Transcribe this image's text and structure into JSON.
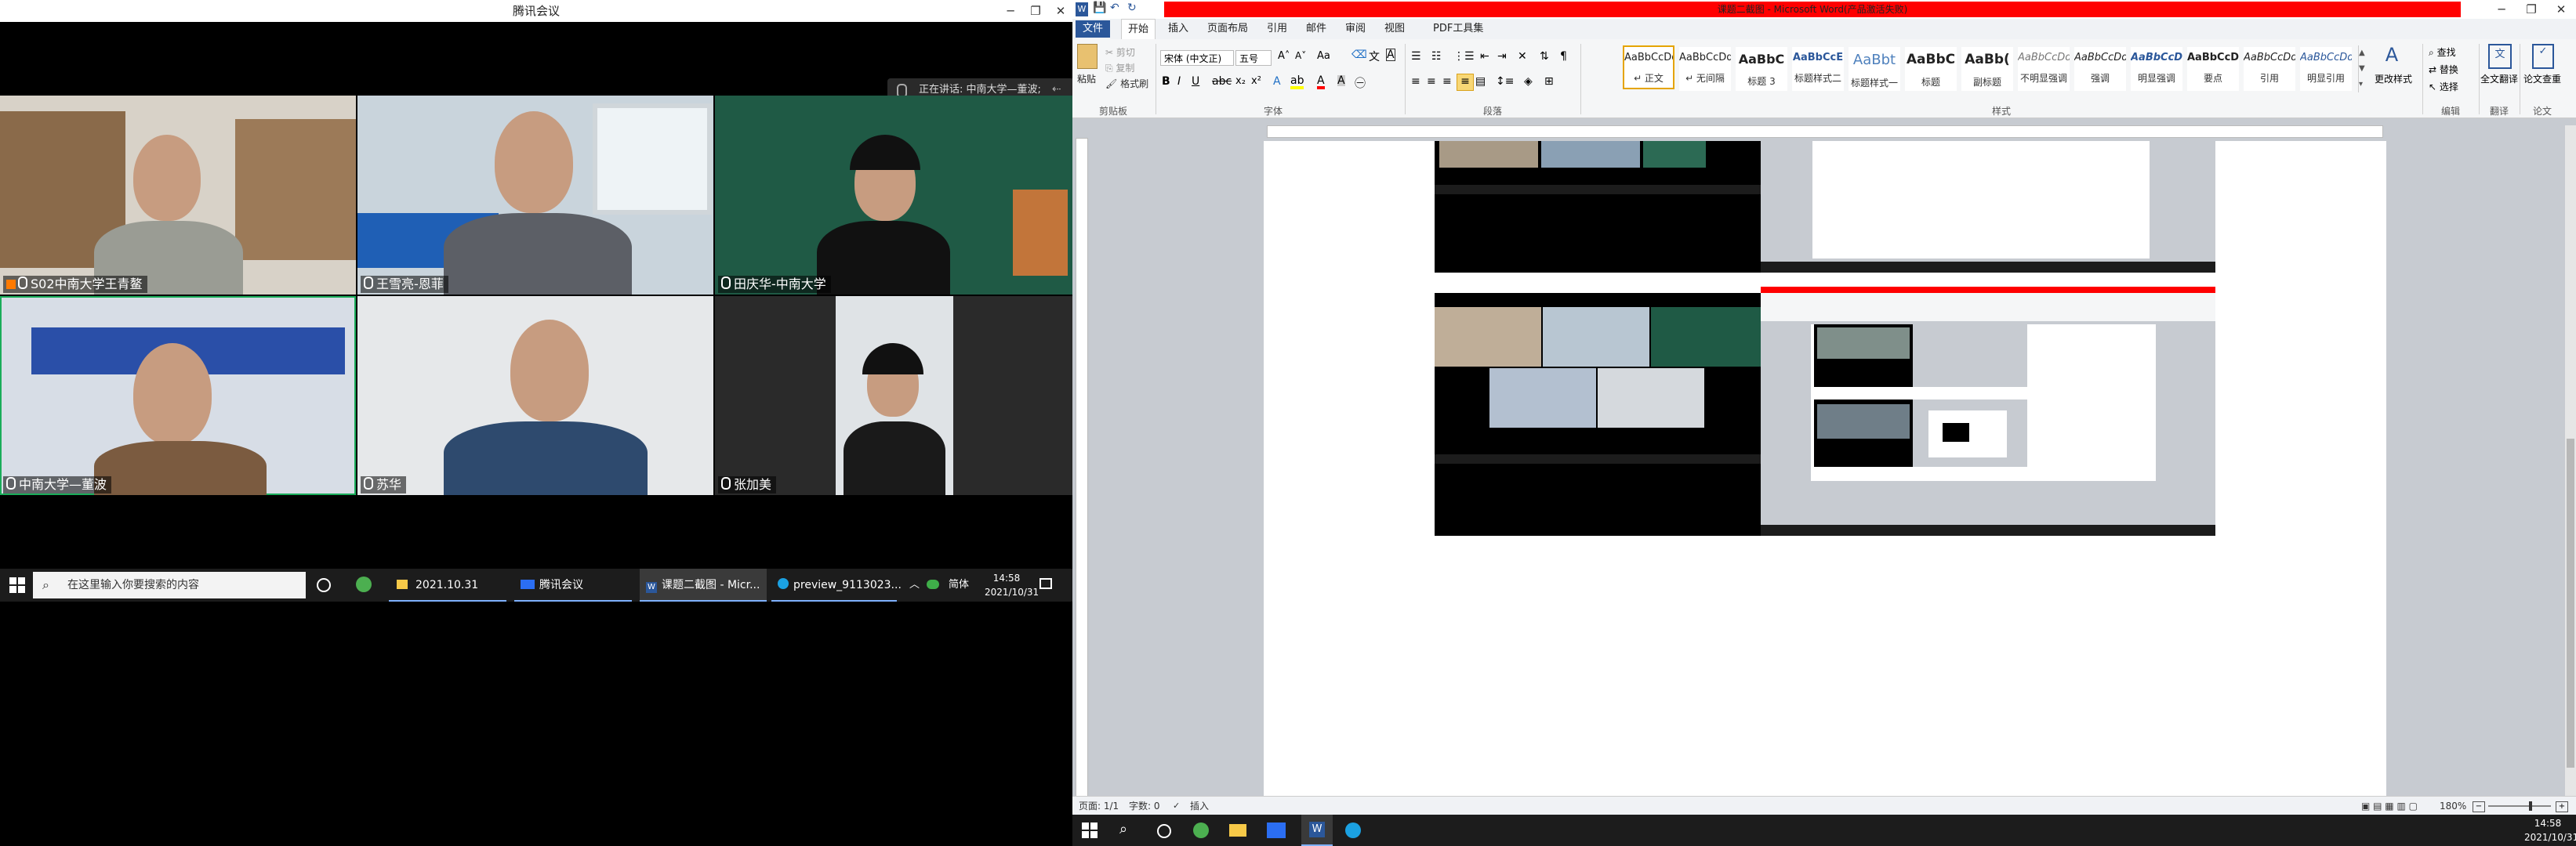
{
  "meeting": {
    "window_title": "腾讯会议",
    "speaking_text": "正在讲话: 中南大学—董波;",
    "participants": [
      {
        "name": "S02中南大学王青鳌"
      },
      {
        "name": "王雪亮-恩菲"
      },
      {
        "name": "田庆华-中南大学"
      },
      {
        "name": "中南大学—董波"
      },
      {
        "name": "苏华"
      },
      {
        "name": "张加美"
      }
    ]
  },
  "left_taskbar": {
    "search_placeholder": "在这里输入你要搜索的内容",
    "apps": [
      {
        "label": "2021.10.31"
      },
      {
        "label": "腾讯会议"
      },
      {
        "label": "课题二截图 - Micr..."
      },
      {
        "label": "preview_9113023..."
      }
    ],
    "ime": "简体",
    "time": "14:58",
    "date": "2021/10/31"
  },
  "word": {
    "title": "课题二截图 - Microsoft Word(产品激活失败)",
    "tabs": [
      {
        "label": "文件"
      },
      {
        "label": "开始"
      },
      {
        "label": "插入"
      },
      {
        "label": "页面布局"
      },
      {
        "label": "引用"
      },
      {
        "label": "邮件"
      },
      {
        "label": "审阅"
      },
      {
        "label": "视图"
      },
      {
        "label": "PDF工具集"
      }
    ],
    "clipboard": {
      "paste": "粘贴",
      "cut": "剪切",
      "copy": "复制",
      "format_painter": "格式刷",
      "group": "剪贴板"
    },
    "font": {
      "name": "宋体 (中文正)",
      "size": "五号",
      "group": "字体"
    },
    "paragraph": {
      "group": "段落"
    },
    "styles": {
      "group": "样式",
      "items": [
        {
          "sample": "AaBbCcDd",
          "name": "↵ 正文"
        },
        {
          "sample": "AaBbCcDd",
          "name": "↵ 无间隔"
        },
        {
          "sample": "AaBbC",
          "name": "标题 3"
        },
        {
          "sample": "AaBbCcE",
          "name": "标题样式二"
        },
        {
          "sample": "AaBbt",
          "name": "标题样式一"
        },
        {
          "sample": "AaBbC",
          "name": "标题"
        },
        {
          "sample": "AaBb(",
          "name": "副标题"
        },
        {
          "sample": "AaBbCcDd",
          "name": "不明显强调"
        },
        {
          "sample": "AaBbCcDd",
          "name": "强调"
        },
        {
          "sample": "AaBbCcDd",
          "name": "明显强调"
        },
        {
          "sample": "AaBbCcDd",
          "name": "要点"
        },
        {
          "sample": "AaBbCcDd",
          "name": "引用"
        },
        {
          "sample": "AaBbCcDd",
          "name": "明显引用"
        }
      ],
      "change_styles": "更改样式"
    },
    "editing": {
      "find": "查找",
      "replace": "替换",
      "select": "选择",
      "group": "编辑"
    },
    "translate": {
      "full": "全文翻译",
      "group": "翻译"
    },
    "paper": {
      "check": "论文查重",
      "group": "论文"
    },
    "status": {
      "page": "页面: 1/1",
      "words": "字数: 0",
      "mode": "插入",
      "zoom": "180%"
    },
    "taskbar": {
      "time": "14:58",
      "date": "2021/10/31"
    }
  },
  "colors": {
    "word_blue": "#2b579a",
    "title_red": "#ff0000",
    "meeting_green_border": "#1aad5a"
  }
}
